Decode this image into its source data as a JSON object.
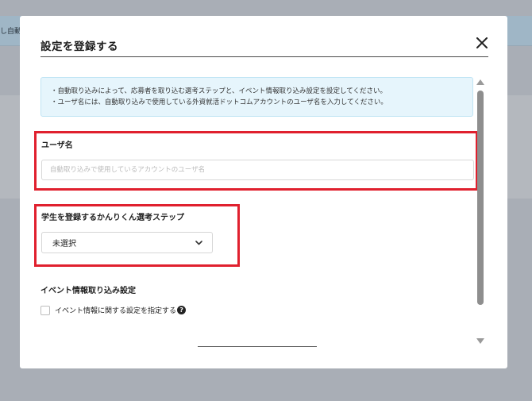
{
  "background": {
    "banner_text": "し自動取"
  },
  "modal": {
    "title": "設定を登録する",
    "close_icon": "close-icon",
    "info_lines": [
      "・自動取り込みによって、応募者を取り込む選考ステップと、イベント情報取り込み設定を設定してください。",
      "・ユーザ名には、自動取り込みで使用している外資就活ドットコムアカウントのユーザ名を入力してください。"
    ],
    "username": {
      "label": "ユーザ名",
      "value": "",
      "placeholder": "自動取り込みで使用しているアカウントのユーザ名"
    },
    "step": {
      "label": "学生を登録するかんりくん選考ステップ",
      "selected": "未選択"
    },
    "event": {
      "heading": "イベント情報取り込み設定",
      "checkbox_label": "イベント情報に関する設定を指定する",
      "checked": false
    }
  },
  "colors": {
    "highlight_red": "#e0202e",
    "info_bg": "#e6f5fc",
    "overlay": "#a9aeb6"
  }
}
